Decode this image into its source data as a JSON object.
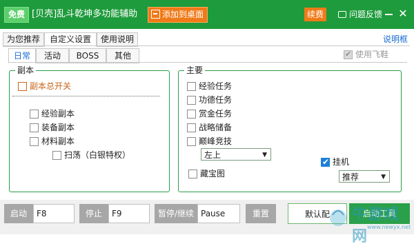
{
  "titlebar": {
    "free_badge": "免费",
    "title": "[贝壳]乱斗乾坤多功能辅助",
    "add_desktop": "添加到桌面",
    "renew": "续费",
    "feedback": "问题反馈",
    "minimize_icon": "minimize-icon",
    "close_icon": "close-icon",
    "close_glyph": "✕"
  },
  "top_tabs": [
    "为您推荐",
    "自定义设置",
    "使用说明"
  ],
  "manual_link": "说明框",
  "sub_tabs": [
    "日常",
    "活动",
    "BOSS",
    "其他"
  ],
  "use_flying_shoes": {
    "label": "使用飞鞋",
    "checked": true
  },
  "dungeon": {
    "title": "副本",
    "master": "副本总开关",
    "items": [
      "经验副本",
      "装备副本",
      "材料副本"
    ],
    "sweep": "扫荡（白银特权）"
  },
  "main": {
    "title": "主要",
    "items": [
      "经验任务",
      "功德任务",
      "赏金任务",
      "战略储备",
      "巅峰竞技"
    ],
    "position_select": "左上",
    "treasure_map": "藏宝图",
    "hangup": {
      "label": "挂机",
      "checked": true
    },
    "hangup_select": "推荐"
  },
  "hotkeys": {
    "start_label": "启动",
    "start_key": "F8",
    "stop_label": "停止",
    "stop_key": "F9",
    "pause_label": "暂停/继续",
    "pause_key": "Pause",
    "reset": "重置"
  },
  "buttons": {
    "default": "默认配",
    "start_tool": "启动工具"
  },
  "watermark": {
    "text": "牛游戏网",
    "url": "www.newyx.net"
  },
  "colors": {
    "title_bar": "#1e9b3c",
    "accent_orange": "#f07a18",
    "link_blue": "#1a6bd1",
    "start_green": "#2aa04a"
  }
}
